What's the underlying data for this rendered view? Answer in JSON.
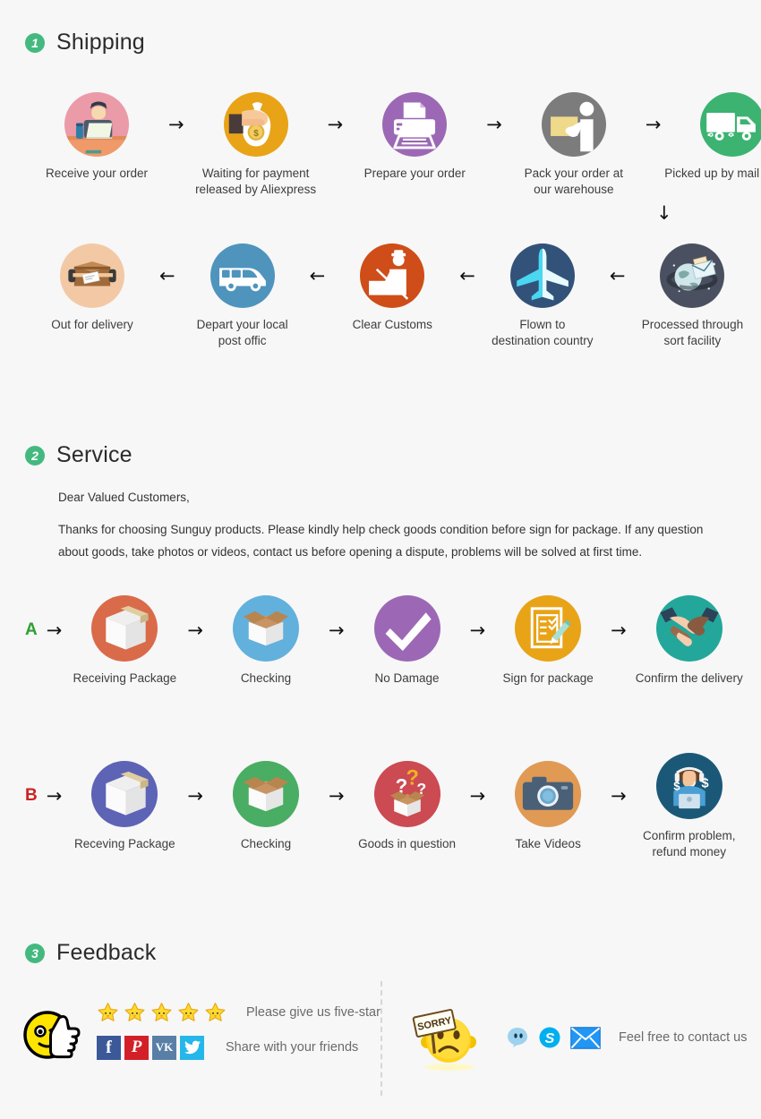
{
  "sections": [
    {
      "num": "1",
      "title": "Shipping"
    },
    {
      "num": "2",
      "title": "Service"
    },
    {
      "num": "3",
      "title": "Feedback"
    }
  ],
  "shipping": {
    "row1": [
      {
        "label": "Receive your order",
        "icon": "person-at-desk-icon",
        "color": "#eb9aa8"
      },
      {
        "label": "Waiting for payment\nreleased by Aliexpress",
        "icon": "hand-money-bag-icon",
        "color": "#e8a317"
      },
      {
        "label": "Prepare your order",
        "icon": "printer-icon",
        "color": "#a濃"
      },
      {
        "label": "Pack your order at\nour warehouse",
        "icon": "worker-packing-icon",
        "color": "#7c7c7c"
      },
      {
        "label": "Picked up by mail service",
        "icon": "delivery-truck-icon",
        "color": "#3cb371"
      }
    ],
    "row2": [
      {
        "label": "Out for delivery",
        "icon": "package-in-van-icon",
        "color": "#f3c9a5"
      },
      {
        "label": "Depart your local\npost offic",
        "icon": "delivery-van-icon",
        "color": "#4f94bd"
      },
      {
        "label": "Clear  Customs",
        "icon": "customs-officer-icon",
        "color": "#cf4d18"
      },
      {
        "label": "Flown to\ndestination country",
        "icon": "airplane-icon",
        "color": "#33527a"
      },
      {
        "label": "Processed through\nsort facility",
        "icon": "globe-mail-icon",
        "color": "#4a5060"
      }
    ],
    "arrow_right": "→",
    "arrow_left": "←",
    "arrow_down": "↓"
  },
  "service": {
    "greeting": "Dear Valued Customers,",
    "paragraph_line1": "Thanks for choosing Sunguy products. Please kindly help check goods condition before sign for package. If any question",
    "paragraph_line2": "about goods, take photos or videos, contact us before opening a dispute, problems will be solved at first time.",
    "rowA": {
      "label": "A",
      "label_color": "#2ea02e",
      "steps": [
        {
          "label": "Receiving Package",
          "icon": "closed-box-icon",
          "color": "#d96b4a"
        },
        {
          "label": "Checking",
          "icon": "open-box-icon",
          "color": "#62b0dc"
        },
        {
          "label": "No Damage",
          "icon": "checkmark-icon",
          "color": "#9c68b5"
        },
        {
          "label": "Sign for package",
          "icon": "sign-document-icon",
          "color": "#e8a317"
        },
        {
          "label": "Confirm the delivery",
          "icon": "handshake-icon",
          "color": "#23a79a"
        }
      ]
    },
    "rowB": {
      "label": "B",
      "label_color": "#cc2222",
      "steps": [
        {
          "label": "Receving Package",
          "icon": "closed-box-icon",
          "color": "#5d63b5"
        },
        {
          "label": "Checking",
          "icon": "open-box-icon",
          "color": "#49ad63"
        },
        {
          "label": "Goods in question",
          "icon": "question-box-icon",
          "color": "#cc4a52"
        },
        {
          "label": "Take Videos",
          "icon": "camera-icon",
          "color": "#e09a54"
        },
        {
          "label": "Confirm problem,\nrefund money",
          "icon": "support-agent-icon",
          "color": "#1b5878"
        }
      ]
    },
    "arrow_right": "→"
  },
  "feedback": {
    "star_count": 5,
    "five_star_text": "Please give us five-star",
    "share_text": "Share with your friends",
    "contact_text": "Feel free to contact us",
    "social": [
      {
        "name": "facebook",
        "glyph": "f",
        "color": "#3b5998"
      },
      {
        "name": "pinterest",
        "glyph": "P",
        "color": "#d32028"
      },
      {
        "name": "vk",
        "glyph": "VK",
        "color": "#5a7fa6"
      },
      {
        "name": "twitter",
        "glyph": "t",
        "color": "#25b6ea"
      }
    ],
    "messengers": [
      {
        "name": "aliwangwang",
        "color": "#7fc4e8"
      },
      {
        "name": "skype",
        "color": "#00aff0"
      },
      {
        "name": "email",
        "color": "#2196f3"
      }
    ],
    "sorry_sign_text": "SORRY"
  }
}
